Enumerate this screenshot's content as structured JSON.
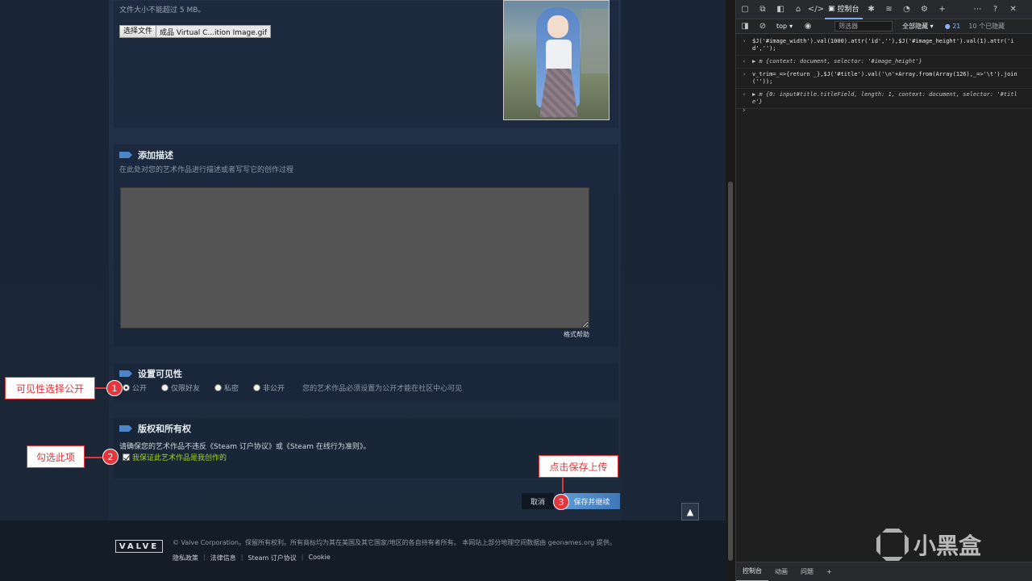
{
  "upload": {
    "size_note": "文件大小不能超过 5 MB。",
    "choose_file_label": "选择文件",
    "file_name": "成品 Virtual C...ition Image.gif"
  },
  "description": {
    "title": "添加描述",
    "subtitle": "在此处对您的艺术作品进行描述或者写写它的创作过程",
    "value": "",
    "format_help": "格式帮助"
  },
  "visibility": {
    "title": "设置可见性",
    "options": [
      "公开",
      "仅限好友",
      "私密",
      "非公开"
    ],
    "selected": "公开",
    "note": "您的艺术作品必须设置为公开才能在社区中心可见"
  },
  "copyright": {
    "title": "版权和所有权",
    "note": "请确保您的艺术作品不违反《Steam 订户协议》或《Steam 在线行为准则》。",
    "checkbox_label": "我保证此艺术作品是我创作的",
    "checked": true
  },
  "actions": {
    "cancel": "取消",
    "save": "保存并继续",
    "scroll_top": "▲"
  },
  "footer": {
    "logo_text": "VALVE",
    "legal": "© Valve Corporation。保留所有权利。所有商标均为其在美国及其它国家/地区的各自持有者所有。 本网站上部分地理空间数据由 geonames.org 提供。",
    "links": [
      "隐私政策",
      "法律信息",
      "Steam 订户协议",
      "Cookie"
    ]
  },
  "annotations": {
    "step1_label": "可见性选择公开",
    "step1_num": "1",
    "step2_label": "勾选此项",
    "step2_num": "2",
    "step3_label": "点击保存上传",
    "step3_num": "3"
  },
  "devtools": {
    "console_tab": "控制台",
    "context": "top",
    "filter_placeholder": "筛选器",
    "levels": "全部隐藏",
    "message_count": "21",
    "hidden_count": "10 个已隐藏",
    "lines": [
      "$J('#image_width').val(1000).attr('id',''),$J('#image_height').val(1).attr('id','');",
      "▶ m {context: document, selector: '#image_height'}",
      "v_trim=_=>{return _},$J('#title').val('\\n'+Array.from(Array(126),_=>'\\t').join(''));",
      "▶ m {0: input#title.titleField, length: 1, context: document, selector: '#title'}"
    ],
    "drawer_tabs": [
      "控制台",
      "动画",
      "问题"
    ]
  },
  "watermark": {
    "text": "小黑盒"
  },
  "colors": {
    "accent_blue": "#4b86c9",
    "annotation_red": "#e0363c",
    "checkbox_green": "#a4d41a"
  }
}
